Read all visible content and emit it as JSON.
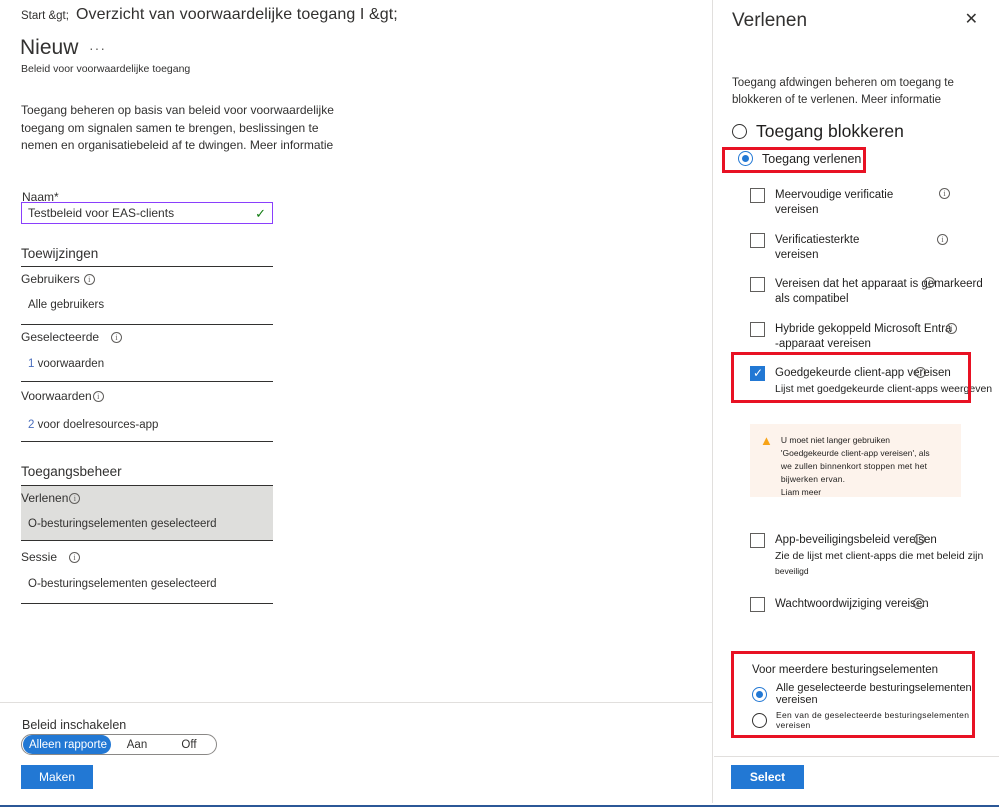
{
  "left": {
    "breadcrumb_start": "Start &gt;",
    "breadcrumb_main": "Overzicht van voorwaardelijke toegang I &gt;",
    "page_title": "Nieuw",
    "ellipsis": "···",
    "subtitle": "Beleid voor voorwaardelijke toegang",
    "intro": "Toegang beheren op basis van beleid voor voorwaardelijke toegang om signalen samen te brengen, beslissingen te nemen en organisatiebeleid af te dwingen. Meer informatie",
    "name_label": "Naam*",
    "name_value": "Testbeleid voor EAS-clients",
    "name_valid_icon": "checkmark-icon",
    "assignments_heading": "Toewijzingen",
    "users_label": "Gebruikers",
    "users_info_icon": "info-icon",
    "users_value": "Alle gebruikers",
    "selected_label": "Geselecteerde",
    "selected_info_icon": "info-icon",
    "selected_count": "1",
    "selected_value": " voorwaarden",
    "conditions_label": "Voorwaarden",
    "conditions_info_icon": "info-icon",
    "conditions_count": "2",
    "conditions_value": " voor doelresources-app",
    "access_heading": "Toegangsbeheer",
    "grant_label": "Verlenen",
    "grant_info_icon": "info-icon",
    "grant_value": "O-besturingselementen geselecteerd",
    "session_label": "Sessie",
    "session_info_icon": "info-icon",
    "session_value": "O-besturingselementen geselecteerd",
    "enable_label": "Beleid inschakelen",
    "toggle_options": [
      "Alleen rapporte",
      "Aan",
      "Off"
    ],
    "toggle_selected_index": 0,
    "create_button": "Maken"
  },
  "right": {
    "title": "Verlenen",
    "close_icon": "close-icon",
    "description": "Toegang afdwingen beheren om toegang te blokkeren of te verlenen. Meer informatie",
    "block_option": "Toegang blokkeren",
    "grant_option": "Toegang verlenen",
    "grant_selected": true,
    "controls": [
      {
        "label_line1": "Meervoudige verificatie",
        "label_line2": "vereisen",
        "checked": false,
        "info_icon": "info-icon"
      },
      {
        "label_line1": "Verificatiesterkte",
        "label_line2": "vereisen",
        "checked": false,
        "info_icon": "info-icon"
      },
      {
        "label_line1": "Vereisen dat het apparaat is gemarkeerd",
        "label_line2": "als compatibel",
        "checked": false,
        "info_icon": "info-icon"
      },
      {
        "label_line1": "Hybride gekoppeld Microsoft Entra",
        "label_line2": "-apparaat vereisen",
        "checked": false,
        "info_icon": "info-icon"
      },
      {
        "label_line1": "Goedgekeurde client-app vereisen",
        "sub": "Lijst met goedgekeurde client-apps weergeven",
        "checked": true,
        "info_icon": "info-icon"
      },
      {
        "label_line1": "App-beveiligingsbeleid vereisen",
        "sub": "Zie de lijst met client-apps die met beleid zijn",
        "sub2": "beveiligd",
        "checked": false,
        "info_icon": "info-icon"
      },
      {
        "label_line1": "Wachtwoordwijziging vereisen",
        "checked": false,
        "info_icon": "info-icon"
      }
    ],
    "warning": {
      "icon": "warning-triangle-icon",
      "line1": "U moet niet langer gebruiken",
      "line2": "'Goedgekeurde client-app vereisen', als",
      "line3": "we zullen binnenkort stoppen met het bijwerken ervan.",
      "line4": "Liam meer"
    },
    "multi_title": "Voor meerdere besturingselementen",
    "multi_options": [
      {
        "label": "Alle geselecteerde besturingselementen vereisen",
        "selected": true
      },
      {
        "label": "Een van de geselecteerde besturingselementen vereisen",
        "selected": false
      }
    ],
    "select_button": "Select"
  },
  "colors": {
    "accent": "#2278d4",
    "highlight_red": "#e81123",
    "input_border": "#8a3ffc",
    "warning_bg": "#fdf3ec",
    "warning_icon": "#f7a317"
  }
}
